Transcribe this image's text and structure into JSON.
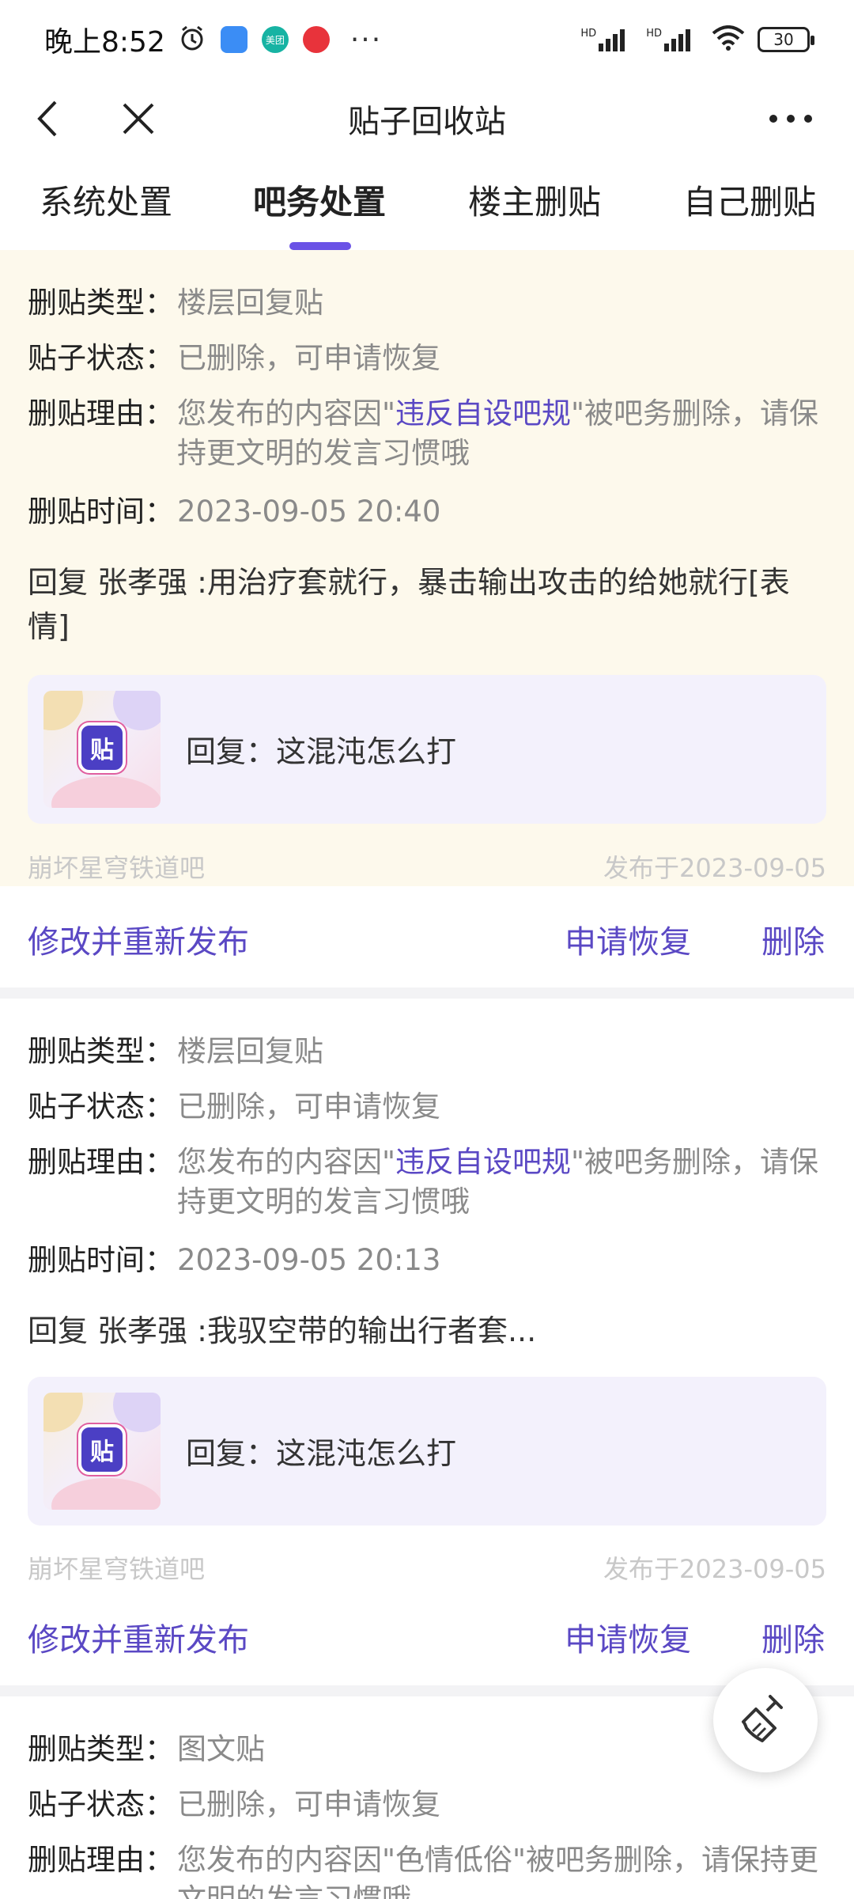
{
  "status_bar": {
    "time": "晚上8:52",
    "dots": "···",
    "signal1": "HD",
    "signal2": "HD",
    "battery": "30",
    "app_icon_meituan": "美团"
  },
  "header": {
    "title": "贴子回收站"
  },
  "tabs": [
    {
      "label": "系统处置"
    },
    {
      "label": "吧务处置"
    },
    {
      "label": "楼主删贴"
    },
    {
      "label": "自己删贴"
    }
  ],
  "labels": {
    "type": "删贴类型：",
    "status": "贴子状态：",
    "reason": "删贴理由：",
    "time": "删贴时间："
  },
  "posts": [
    {
      "type": "楼层回复贴",
      "status": "已删除，可申请恢复",
      "reason_pre": "您发布的内容因\"",
      "reason_link": "违反自设吧规",
      "reason_post": "\"被吧务删除，请保持更文明的发言习惯哦",
      "time": "2023-09-05 20:40",
      "reply": "回复 张孝强 :用治疗套就行，暴击输出攻击的给她就行[表情]",
      "quote": "回复：这混沌怎么打",
      "quote_logo": "贴",
      "forum": "崩坏星穹铁道吧",
      "published": "发布于2023-09-05"
    },
    {
      "type": "楼层回复贴",
      "status": "已删除，可申请恢复",
      "reason_pre": "您发布的内容因\"",
      "reason_link": "违反自设吧规",
      "reason_post": "\"被吧务删除，请保持更文明的发言习惯哦",
      "time": "2023-09-05 20:13",
      "reply": "回复 张孝强 :我驭空带的输出行者套...",
      "quote": "回复：这混沌怎么打",
      "quote_logo": "贴",
      "forum": "崩坏星穹铁道吧",
      "published": "发布于2023-09-05"
    },
    {
      "type": "图文贴",
      "status": "已删除，可申请恢复",
      "reason": "您发布的内容因\"色情低俗\"被吧务删除，请保持更文明的发言习惯哦"
    }
  ],
  "actions": {
    "edit": "修改并重新发布",
    "restore": "申请恢复",
    "delete": "删除"
  },
  "colors": {
    "accent": "#5a48c4",
    "highlight_bg": "#fdf9ec",
    "indicator": "#6a52e6"
  },
  "icons": [
    "back-icon",
    "close-icon",
    "more-icon",
    "broom-icon",
    "alarm-icon",
    "wifi-icon",
    "signal-icon",
    "battery-icon"
  ]
}
